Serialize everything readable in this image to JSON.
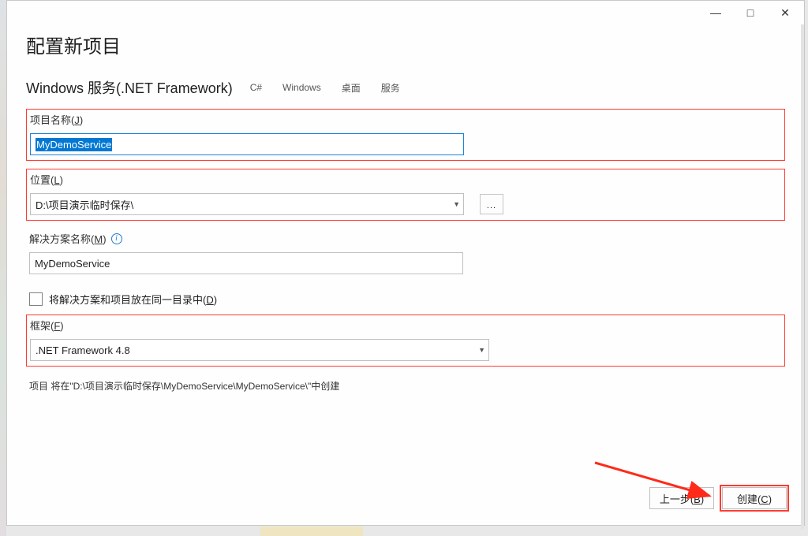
{
  "titlebar": {
    "min": "—",
    "max": "□",
    "close": "✕"
  },
  "page_title": "配置新项目",
  "subtitle": "Windows 服务(.NET Framework)",
  "tags": [
    "C#",
    "Windows",
    "桌面",
    "服务"
  ],
  "project_name": {
    "label_prefix": "项目名称(",
    "label_key": "J",
    "label_suffix": ")",
    "value": "MyDemoService"
  },
  "location": {
    "label_prefix": "位置(",
    "label_key": "L",
    "label_suffix": ")",
    "value": "D:\\项目演示临时保存\\",
    "browse": "..."
  },
  "solution_name": {
    "label_prefix": "解决方案名称(",
    "label_key": "M",
    "label_suffix": ")",
    "value": "MyDemoService"
  },
  "same_dir_checkbox": {
    "label_prefix": "将解决方案和项目放在同一目录中(",
    "label_key": "D",
    "label_suffix": ")"
  },
  "framework": {
    "label_prefix": "框架(",
    "label_key": "F",
    "label_suffix": ")",
    "value": ".NET Framework 4.8"
  },
  "footnote": "项目 将在\"D:\\项目演示临时保存\\MyDemoService\\MyDemoService\\\"中创建",
  "buttons": {
    "back_prefix": "上一步(",
    "back_key": "B",
    "back_suffix": ")",
    "create_prefix": "创建(",
    "create_key": "C",
    "create_suffix": ")"
  }
}
